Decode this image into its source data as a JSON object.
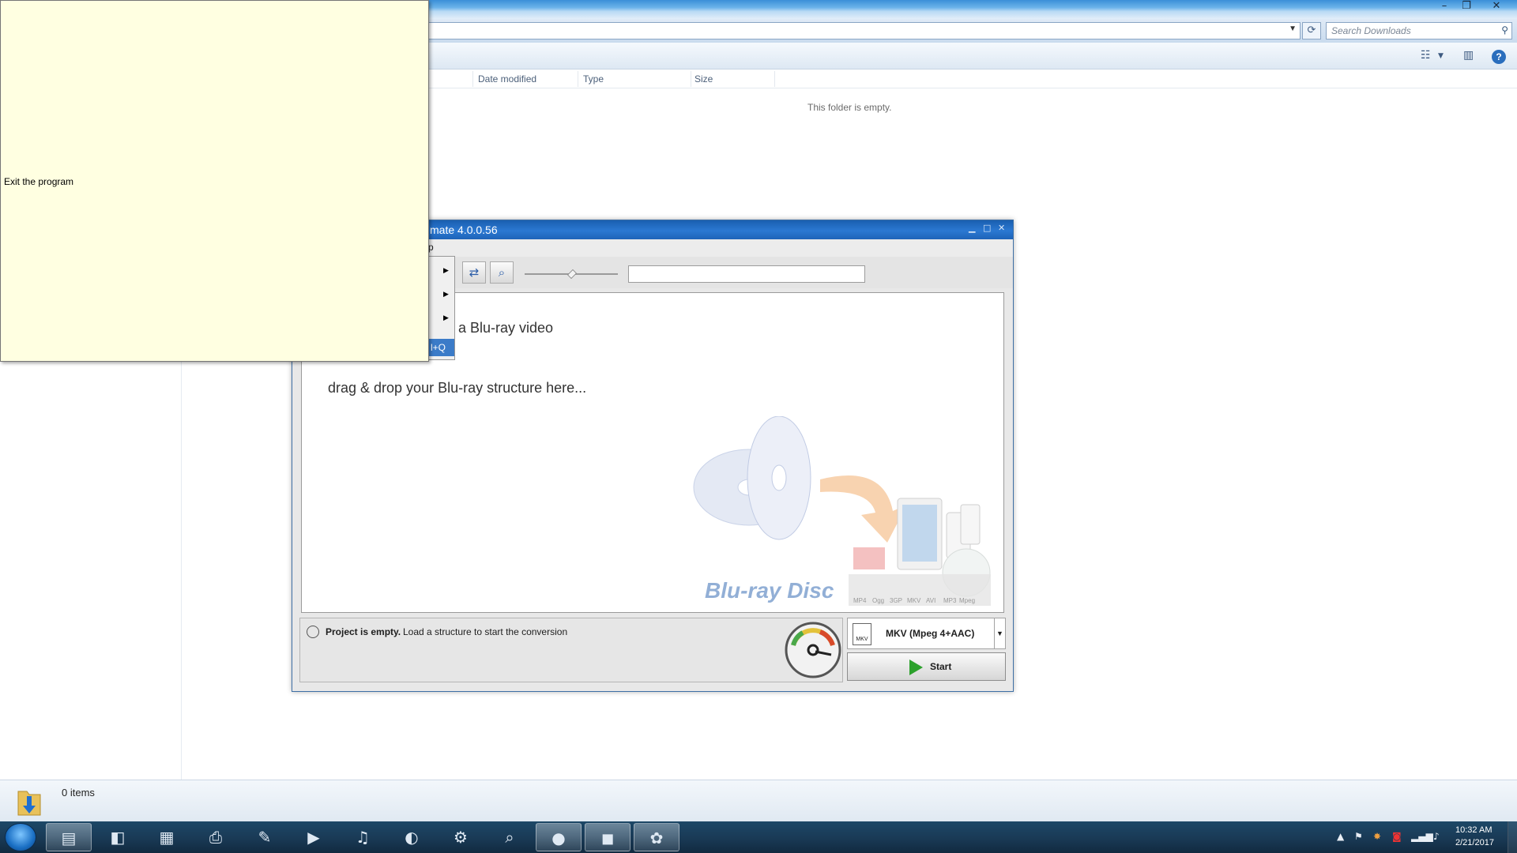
{
  "explorer": {
    "search": {
      "placeholder": "Search Downloads"
    },
    "columns": [
      "Date modified",
      "Type",
      "Size"
    ],
    "empty_message": "This folder is empty.",
    "status": {
      "items_count": "0 items"
    }
  },
  "tooltip": {
    "text": "Exit the program"
  },
  "menu": {
    "highlighted_shortcut_fragment": "l+Q"
  },
  "app": {
    "title_fragment": "mate 4.0.0.56",
    "menu_fragment": "p",
    "drop_text_1": "a Blu-ray video",
    "drop_text_2": "drag & drop your Blu-ray structure here...",
    "bluray_logo_text": "Blu-ray Disc",
    "format_badges": [
      "MP4",
      "Ogg",
      "3GP",
      "MKV",
      "AVI",
      "MP3",
      "Mpeg"
    ],
    "status_bold": "Project is empty.",
    "status_message": "Load a structure to start the conversion",
    "format_selected": "MKV (Mpeg 4+AAC)",
    "format_icon_label": "MKV",
    "start_label": "Start"
  },
  "taskbar": {
    "time": "10:32 AM",
    "date": "2/21/2017"
  },
  "colors": {
    "titlebar_blue": "#2b78d2",
    "tooltip_bg": "#ffffe1",
    "start_green": "#2ca12c",
    "taskbar_bg": "#1a3b57"
  }
}
